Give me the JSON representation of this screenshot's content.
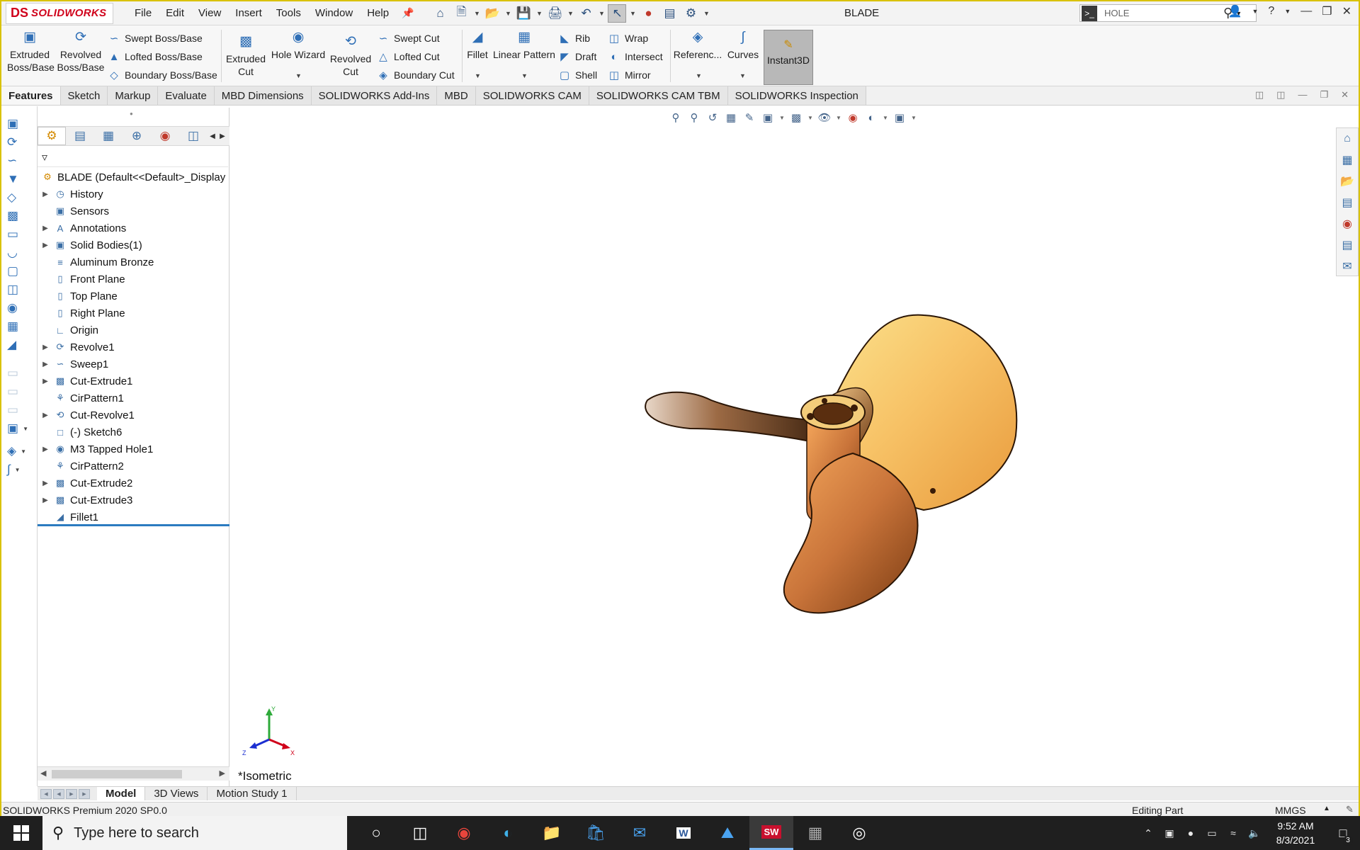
{
  "app": {
    "logo_ds": "DS",
    "logo_text": "SOLIDWORKS",
    "document_title": "BLADE",
    "menus": [
      "File",
      "Edit",
      "View",
      "Insert",
      "Tools",
      "Window",
      "Help"
    ],
    "search_value": "HOLE"
  },
  "commands": {
    "extruded_boss": "Extruded Boss/Base",
    "revolved_boss": "Revolved Boss/Base",
    "swept_boss": "Swept Boss/Base",
    "lofted_boss": "Lofted Boss/Base",
    "boundary_boss": "Boundary Boss/Base",
    "extruded_cut": "Extruded Cut",
    "hole_wizard": "Hole Wizard",
    "revolved_cut": "Revolved Cut",
    "swept_cut": "Swept Cut",
    "lofted_cut": "Lofted Cut",
    "boundary_cut": "Boundary Cut",
    "fillet": "Fillet",
    "linear_pattern": "Linear Pattern",
    "rib": "Rib",
    "draft": "Draft",
    "shell": "Shell",
    "wrap": "Wrap",
    "intersect": "Intersect",
    "mirror": "Mirror",
    "reference": "Referenc...",
    "curves": "Curves",
    "instant3d": "Instant3D"
  },
  "tabs": [
    {
      "label": "Features",
      "active": true
    },
    {
      "label": "Sketch"
    },
    {
      "label": "Markup"
    },
    {
      "label": "Evaluate"
    },
    {
      "label": "MBD Dimensions"
    },
    {
      "label": "SOLIDWORKS Add-Ins"
    },
    {
      "label": "MBD"
    },
    {
      "label": "SOLIDWORKS CAM"
    },
    {
      "label": "SOLIDWORKS CAM TBM"
    },
    {
      "label": "SOLIDWORKS Inspection"
    }
  ],
  "tree": {
    "root": "BLADE  (Default<<Default>_Display",
    "items": [
      {
        "label": "History",
        "icon": "history-icon",
        "expandable": true
      },
      {
        "label": "Sensors",
        "icon": "sensor-icon",
        "expandable": false
      },
      {
        "label": "Annotations",
        "icon": "annotation-icon",
        "expandable": true
      },
      {
        "label": "Solid Bodies(1)",
        "icon": "solid-bodies-icon",
        "expandable": true
      },
      {
        "label": "Aluminum Bronze",
        "icon": "material-icon",
        "expandable": false
      },
      {
        "label": "Front Plane",
        "icon": "plane-icon",
        "expandable": false
      },
      {
        "label": "Top Plane",
        "icon": "plane-icon",
        "expandable": false
      },
      {
        "label": "Right Plane",
        "icon": "plane-icon",
        "expandable": false
      },
      {
        "label": "Origin",
        "icon": "origin-icon",
        "expandable": false
      },
      {
        "label": "Revolve1",
        "icon": "revolve-icon",
        "expandable": true
      },
      {
        "label": "Sweep1",
        "icon": "sweep-icon",
        "expandable": true
      },
      {
        "label": "Cut-Extrude1",
        "icon": "cut-extrude-icon",
        "expandable": true
      },
      {
        "label": "CirPattern1",
        "icon": "circular-pattern-icon",
        "expandable": false
      },
      {
        "label": "Cut-Revolve1",
        "icon": "cut-revolve-icon",
        "expandable": true
      },
      {
        "label": "(-) Sketch6",
        "icon": "sketch-icon",
        "expandable": false
      },
      {
        "label": "M3 Tapped Hole1",
        "icon": "hole-icon",
        "expandable": true
      },
      {
        "label": "CirPattern2",
        "icon": "circular-pattern-icon",
        "expandable": false
      },
      {
        "label": "Cut-Extrude2",
        "icon": "cut-extrude-icon",
        "expandable": true
      },
      {
        "label": "Cut-Extrude3",
        "icon": "cut-extrude-icon",
        "expandable": true
      },
      {
        "label": "Fillet1",
        "icon": "fillet-icon",
        "expandable": false
      }
    ]
  },
  "viewport": {
    "view_label": "*Isometric",
    "triad": {
      "y": "Y",
      "x": "X",
      "z": "Z"
    }
  },
  "bottom_tabs": [
    {
      "label": "Model",
      "active": true
    },
    {
      "label": "3D Views"
    },
    {
      "label": "Motion Study 1"
    }
  ],
  "status": {
    "product": "SOLIDWORKS Premium 2020 SP0.0",
    "mode": "Editing Part",
    "units": "MMGS"
  },
  "taskbar": {
    "search_placeholder": "Type here to search",
    "time": "9:52 AM",
    "date": "8/3/2021",
    "notification_count": "3",
    "solidworks_badge": "SW"
  },
  "colors": {
    "accent_blue": "#2f6fb6",
    "solidworks_red": "#d0021b",
    "bronze_light": "#f7c266",
    "bronze_dark": "#8a4a16"
  }
}
